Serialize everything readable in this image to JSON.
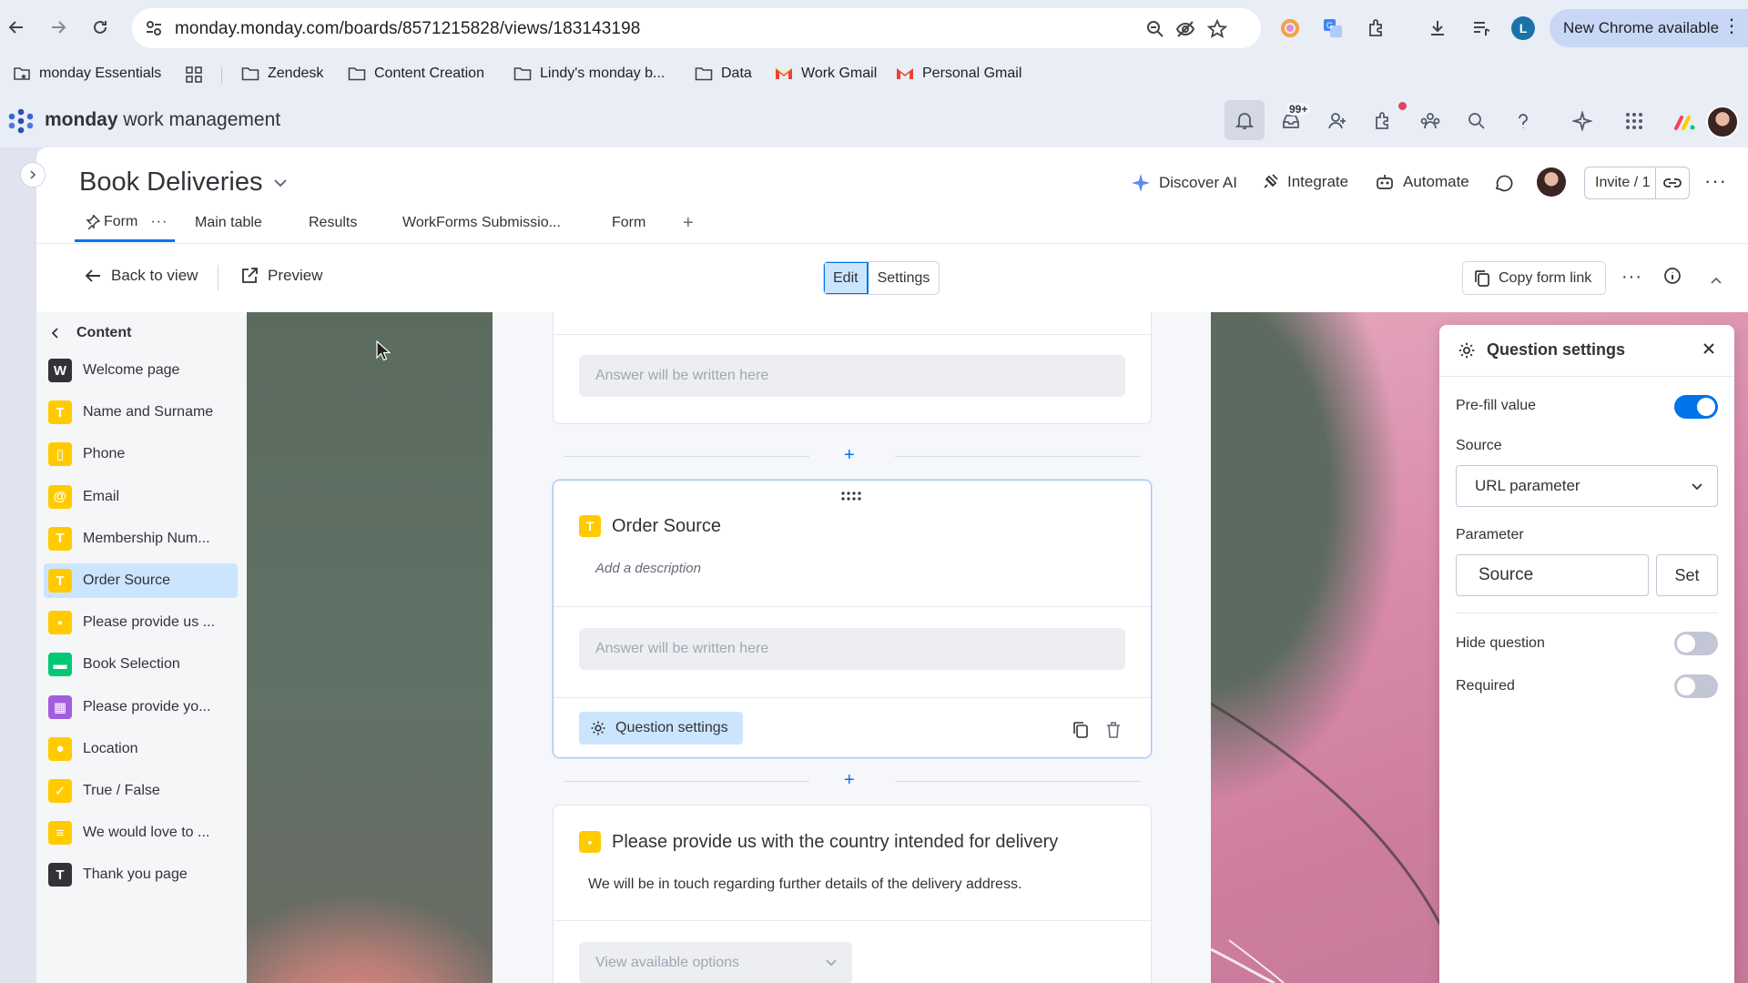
{
  "browser": {
    "url": "monday.monday.com/boards/8571215828/views/183143198",
    "profile_initial": "L",
    "update_button": "New Chrome available"
  },
  "bookmarks": [
    {
      "label": "monday Essentials",
      "icon": "bookmark-manager-icon"
    },
    {
      "label": "Zendesk",
      "icon": "folder-icon"
    },
    {
      "label": "Content Creation",
      "icon": "folder-icon"
    },
    {
      "label": "Lindy's monday b...",
      "icon": "folder-icon"
    },
    {
      "label": "Data",
      "icon": "folder-icon"
    },
    {
      "label": "Work Gmail",
      "icon": "gmail-icon"
    },
    {
      "label": "Personal Gmail",
      "icon": "gmail-icon"
    }
  ],
  "app": {
    "brand_bold": "monday",
    "brand_rest": " work management",
    "notifications_badge": "99+"
  },
  "board": {
    "title": "Book Deliveries",
    "actions": {
      "discover_ai": "Discover AI",
      "integrate": "Integrate",
      "automate": "Automate",
      "invite": "Invite / 1"
    },
    "tabs": [
      {
        "label": "Form",
        "active": true
      },
      {
        "label": "Main table"
      },
      {
        "label": "Results"
      },
      {
        "label": "WorkForms Submissio..."
      },
      {
        "label": "Form"
      }
    ]
  },
  "toolbar": {
    "back": "Back to view",
    "preview": "Preview",
    "edit": "Edit",
    "settings": "Settings",
    "copy_link": "Copy form link"
  },
  "sidebar": {
    "title": "Content",
    "items": [
      {
        "label": "Welcome page",
        "icon_char": "W",
        "color": "#323338"
      },
      {
        "label": "Name and Surname",
        "icon_char": "T",
        "color": "#ffcb00"
      },
      {
        "label": "Phone",
        "icon_char": "▯",
        "color": "#ffcb00"
      },
      {
        "label": "Email",
        "icon_char": "@",
        "color": "#ffcb00"
      },
      {
        "label": "Membership Num...",
        "icon_char": "T",
        "color": "#ffcb00"
      },
      {
        "label": "Order Source",
        "icon_char": "T",
        "color": "#ffcb00",
        "selected": true
      },
      {
        "label": "Please provide us ...",
        "icon_char": "▪",
        "color": "#ffcb00"
      },
      {
        "label": "Book Selection",
        "icon_char": "▬",
        "color": "#00c875"
      },
      {
        "label": "Please provide yo...",
        "icon_char": "▦",
        "color": "#a25ddc"
      },
      {
        "label": "Location",
        "icon_char": "●",
        "color": "#ffcb00"
      },
      {
        "label": "True / False",
        "icon_char": "✓",
        "color": "#ffcb00"
      },
      {
        "label": "We would love to ...",
        "icon_char": "≡",
        "color": "#ffcb00"
      },
      {
        "label": "Thank you page",
        "icon_char": "T",
        "color": "#323338"
      }
    ]
  },
  "form": {
    "answer_placeholder": "Answer will be written here",
    "order_source": {
      "title": "Order Source",
      "description_placeholder": "Add a description",
      "answer_placeholder": "Answer will be written here",
      "settings_button": "Question settings"
    },
    "country": {
      "title": "Please provide us with the country intended for delivery",
      "description": "We will be in touch regarding further details of the delivery address.",
      "dropdown_placeholder": "View available options"
    }
  },
  "question_settings": {
    "title": "Question settings",
    "prefill_label": "Pre-fill value",
    "prefill_on": true,
    "source_label": "Source",
    "source_value": "URL parameter",
    "parameter_label": "Parameter",
    "parameter_value": "Source",
    "set_button": "Set",
    "hide_label": "Hide question",
    "hide_on": false,
    "required_label": "Required",
    "required_on": false
  },
  "colors": {
    "accent": "#0073ea",
    "selected_bg": "#cce5ff",
    "question_icon": "#ffcb00"
  }
}
